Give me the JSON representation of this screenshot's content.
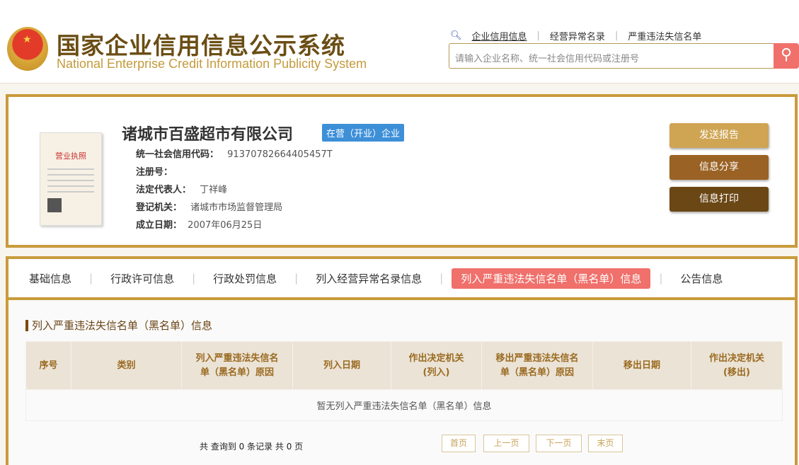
{
  "header": {
    "title_cn": "国家企业信用信息公示系统",
    "title_en": "National Enterprise Credit Information Publicity System",
    "links": [
      "企业信用信息",
      "经营异常名录",
      "严重违法失信名单"
    ],
    "search_placeholder": "请输入企业名称、统一社会信用代码或注册号"
  },
  "company": {
    "name": "诸城市百盛超市有限公司",
    "status": "在营（开业）企业",
    "license_title": "营业执照",
    "fields": [
      {
        "label": "统一社会信用代码：",
        "value": "91370782664405457T"
      },
      {
        "label": "注册号：",
        "value": ""
      },
      {
        "label": "法定代表人：",
        "value": "丁祥峰"
      },
      {
        "label": "登记机关：",
        "value": "诸城市市场监督管理局"
      },
      {
        "label": "成立日期：",
        "value": "2007年06月25日"
      }
    ],
    "buttons": [
      "发送报告",
      "信息分享",
      "信息打印"
    ]
  },
  "tabs": [
    "基础信息",
    "行政许可信息",
    "行政处罚信息",
    "列入经营异常名录信息",
    "列入严重违法失信名单（黑名单）信息",
    "公告信息"
  ],
  "section": {
    "title": "列入严重违法失信名单（黑名单）信息",
    "columns": [
      "序号",
      "类别",
      "列入严重违法失信名单（黑名单）原因",
      "列入日期",
      "作出决定机关(列入)",
      "移出严重违法失信名单（黑名单）原因",
      "移出日期",
      "作出决定机关(移出)"
    ],
    "empty": "暂无列入严重违法失信名单（黑名单）信息"
  },
  "pagination": {
    "summary": "共 查询到 0 条记录 共 0 页",
    "first": "首页",
    "prev": "上一页",
    "next": "下一页",
    "last": "末页"
  }
}
